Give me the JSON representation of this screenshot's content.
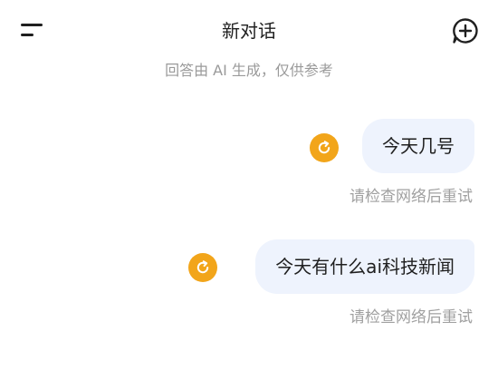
{
  "header": {
    "title": "新对话",
    "subtitle": "回答由 AI 生成，仅供参考"
  },
  "icons": {
    "menu": "menu-icon",
    "new_chat": "chat-plus-icon",
    "retry": "refresh-icon"
  },
  "colors": {
    "bubble_bg": "#eef3fd",
    "retry_badge": "#f2a51a",
    "muted_text": "#9a9a9a"
  },
  "messages": [
    {
      "text": "今天几号",
      "status": "请检查网络后重试"
    },
    {
      "text": "今天有什么ai科技新闻",
      "status": "请检查网络后重试"
    }
  ]
}
